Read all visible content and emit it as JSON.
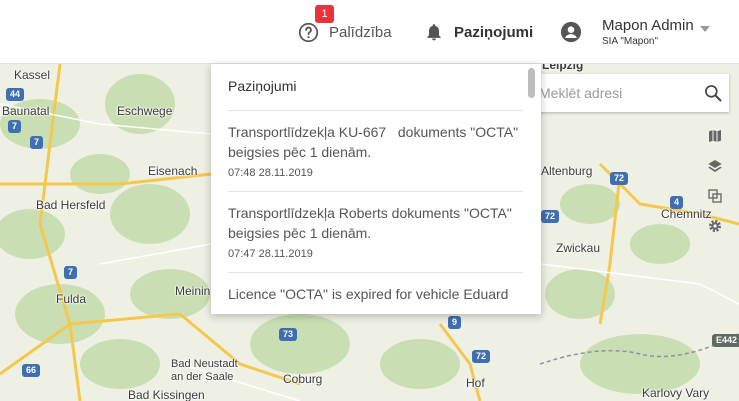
{
  "header": {
    "help_label": "Palīdzība",
    "help_badge": "1",
    "notifications_label": "Paziņojumi",
    "user_name": "Mapon Admin",
    "company_name": "SIA \"Mapon\""
  },
  "search": {
    "placeholder": "Meklēt adresi"
  },
  "notifications_panel": {
    "title": "Paziņojumi",
    "items": [
      {
        "message": "Transportlīdzekļa KU-667   dokuments \"OCTA\" beigsies pēc 1 dienām.",
        "time": "07:48 28.11.2019"
      },
      {
        "message": "Transportlīdzekļa Roberts dokuments \"OCTA\" beigsies pēc 1 dienām.",
        "time": "07:47 28.11.2019"
      },
      {
        "message": "Licence \"OCTA\" is expired for vehicle Eduard",
        "time": ""
      }
    ]
  },
  "map": {
    "cities": {
      "kassel": "Kassel",
      "baunatal": "Baunatal",
      "eschwege": "Eschwege",
      "eisenach": "Eisenach",
      "bad_hersfeld": "Bad Hersfeld",
      "fulda": "Fulda",
      "meiningen": "Meinin",
      "bad_neustadt": "Bad Neustadt\nan der Saale",
      "coburg": "Coburg",
      "bad_kissingen": "Bad Kissingen",
      "hof": "Hof",
      "leipzig": "Leipzig",
      "altenburg": "Altenburg",
      "chemnitz": "Chemnitz",
      "zwickau": "Zwickau",
      "karlovy_vary": "Karlovy Vary"
    },
    "shields": {
      "a44": "44",
      "a7_top": "7",
      "a7_mid": "7",
      "a7_low": "7",
      "a66": "66",
      "a73": "73",
      "a9": "9",
      "a72_a": "72",
      "a72_b": "72",
      "a72_c": "72",
      "a4": "4",
      "e442": "E442"
    },
    "colors": {
      "land": "#eef0e4",
      "forest": "#c9dfb3",
      "highway": "#f5c84c",
      "border": "#8f8fa8"
    }
  }
}
